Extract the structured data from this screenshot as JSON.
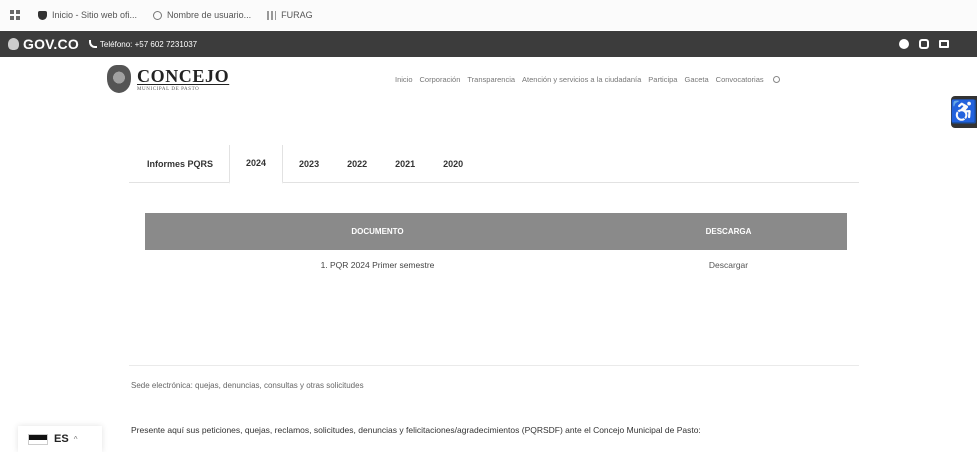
{
  "bookmarks": {
    "items": [
      {
        "label": "Inicio - Sitio web ofi..."
      },
      {
        "label": "Nombre de usuario..."
      },
      {
        "label": "FURAG"
      }
    ]
  },
  "govbar": {
    "logo": "GOV.CO",
    "phone": "Teléfono: +57 602 7231037"
  },
  "header": {
    "logo_title": "CONCEJO",
    "logo_sub": "MUNICIPAL DE PASTO",
    "nav": [
      "Inicio",
      "Corporación",
      "Transparencia",
      "Atención y servicios a la ciudadanía",
      "Participa",
      "Gaceta",
      "Convocatorias"
    ]
  },
  "tabs": [
    {
      "label": "Informes PQRS"
    },
    {
      "label": "2024"
    },
    {
      "label": "2023"
    },
    {
      "label": "2022"
    },
    {
      "label": "2021"
    },
    {
      "label": "2020"
    }
  ],
  "table": {
    "headers": [
      "DOCUMENTO",
      "DESCARGA"
    ],
    "rows": [
      {
        "document": "1. PQR 2024 Primer semestre",
        "download": "Descargar"
      }
    ]
  },
  "sede_text": "Sede electrónica: quejas, denuncias, consultas y otras solicitudes",
  "presente_text": "Presente aquí sus peticiones, quejas, reclamos, solicitudes, denuncias y felicitaciones/agradecimientos (PQRSDF) ante el Concejo Municipal de Pasto:",
  "language": {
    "code": "ES"
  }
}
